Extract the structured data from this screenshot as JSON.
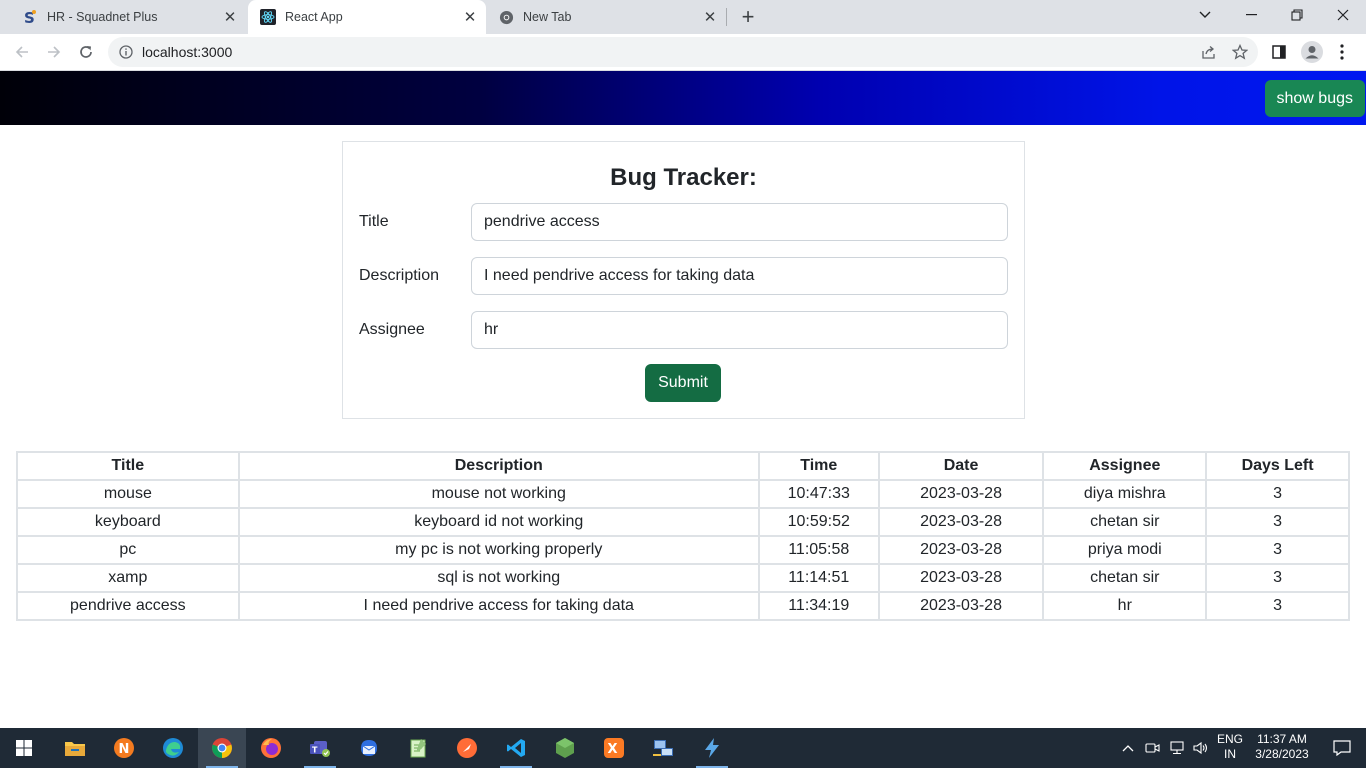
{
  "browser": {
    "tabs": [
      {
        "title": "HR - Squadnet Plus",
        "active": false
      },
      {
        "title": "React App",
        "active": true
      },
      {
        "title": "New Tab",
        "active": false
      }
    ],
    "url": "localhost:3000"
  },
  "header": {
    "show_bugs_label": "show bugs"
  },
  "form": {
    "heading": "Bug Tracker:",
    "title_label": "Title",
    "title_value": "pendrive access",
    "description_label": "Description",
    "description_value": "I need pendrive access for taking data",
    "assignee_label": "Assignee",
    "assignee_value": "hr",
    "submit_label": "Submit"
  },
  "table": {
    "columns": [
      "Title",
      "Description",
      "Time",
      "Date",
      "Assignee",
      "Days Left"
    ],
    "rows": [
      [
        "mouse",
        "mouse not working",
        "10:47:33",
        "2023-03-28",
        "diya mishra",
        "3"
      ],
      [
        "keyboard",
        "keyboard id not working",
        "10:59:52",
        "2023-03-28",
        "chetan sir",
        "3"
      ],
      [
        "pc",
        "my pc is not working properly",
        "11:05:58",
        "2023-03-28",
        "priya modi",
        "3"
      ],
      [
        "xamp",
        "sql is not working",
        "11:14:51",
        "2023-03-28",
        "chetan sir",
        "3"
      ],
      [
        "pendrive access",
        "I need pendrive access for taking data",
        "11:34:19",
        "2023-03-28",
        "hr",
        "3"
      ]
    ]
  },
  "taskbar": {
    "language": "ENG",
    "region": "IN",
    "time": "11:37 AM",
    "date": "3/28/2023",
    "apps": [
      "start-icon",
      "file-explorer-icon",
      "app-n-icon",
      "edge-icon",
      "chrome-icon",
      "firefox-icon",
      "teams-icon",
      "outlook-icon",
      "notepad-plus-icon",
      "postman-icon",
      "vscode-icon",
      "nodejs-icon",
      "xampp-icon",
      "network-tool-icon",
      "thunder-client-icon"
    ]
  },
  "colors": {
    "primary_green": "#198754",
    "submit_green": "#146c43",
    "header_gradient_end": "#0018f0"
  }
}
